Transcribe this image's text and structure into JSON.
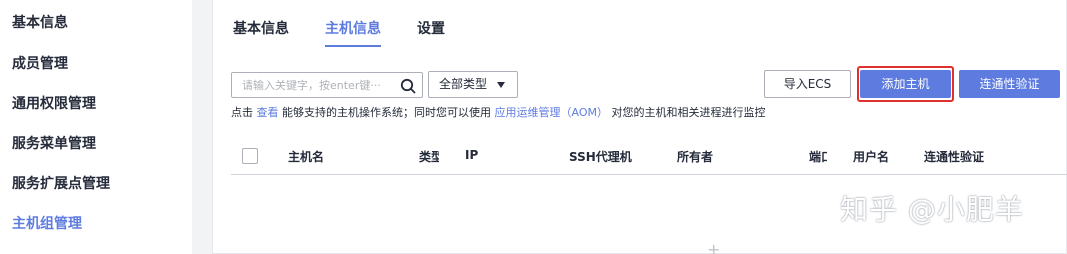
{
  "sidebar": {
    "items": [
      {
        "label": "基本信息"
      },
      {
        "label": "成员管理"
      },
      {
        "label": "通用权限管理"
      },
      {
        "label": "服务菜单管理"
      },
      {
        "label": "服务扩展点管理"
      },
      {
        "label": "主机组管理",
        "active": true
      }
    ]
  },
  "tabs": [
    {
      "label": "基本信息"
    },
    {
      "label": "主机信息",
      "active": true
    },
    {
      "label": "设置"
    }
  ],
  "toolbar": {
    "search_placeholder": "请输入关键字，按enter键···",
    "type_select": "全部类型",
    "import_label": "导入ECS",
    "add_label": "添加主机",
    "verify_label": "连通性验证"
  },
  "hint": {
    "prefix": "点击",
    "link1": "查看",
    "middle": "能够支持的主机操作系统；同时您可以使用",
    "link2": "应用运维管理（AOM）",
    "suffix": "对您的主机和相关进程进行监控"
  },
  "table": {
    "columns": [
      "主机名",
      "类型",
      "IP",
      "SSH代理机",
      "所有者",
      "端口",
      "用户名",
      "连通性验证"
    ]
  },
  "empty_plus": "+",
  "watermark": "知乎 @小肥羊",
  "colors": {
    "accent": "#5e7ce0",
    "highlight": "#e03030"
  }
}
